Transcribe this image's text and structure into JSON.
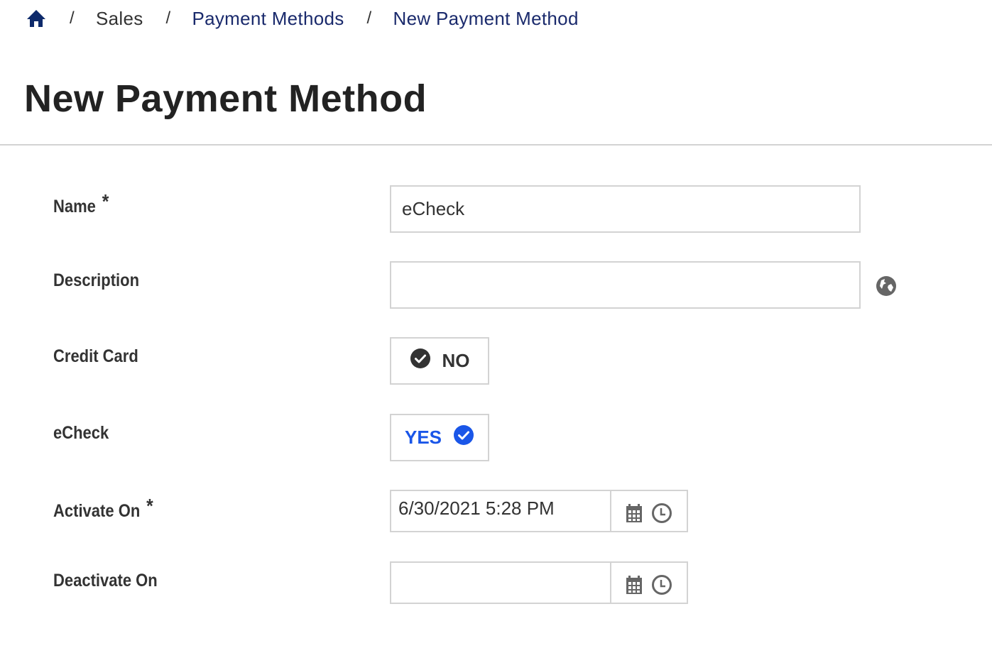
{
  "breadcrumb": {
    "home_icon": "home-icon",
    "separator": "/",
    "items": [
      {
        "label": "Sales",
        "link": false
      },
      {
        "label": "Payment Methods",
        "link": true
      },
      {
        "label": "New Payment Method",
        "link": true
      }
    ]
  },
  "page": {
    "title": "New Payment Method"
  },
  "colors": {
    "breadcrumb_link": "#1a2a6c",
    "home_icon": "#0e2a6b",
    "accent_yes": "#1a56e8",
    "toggle_no": "#333333",
    "border": "#d3d3d3",
    "icon_gray": "#666666"
  },
  "form": {
    "name": {
      "label": "Name",
      "required_mark": "*",
      "value": "eCheck"
    },
    "description": {
      "label": "Description",
      "value": "",
      "globe_icon": "globe-icon"
    },
    "credit_card": {
      "label": "Credit Card",
      "state_label": "NO",
      "checked": false,
      "icon": "check-circle-icon"
    },
    "echeck": {
      "label": "eCheck",
      "state_label": "YES",
      "checked": true,
      "icon": "check-circle-icon"
    },
    "activate_on": {
      "label": "Activate On",
      "required_mark": "*",
      "value": "6/30/2021 5:28 PM",
      "calendar_icon": "calendar-icon",
      "clock_icon": "clock-icon"
    },
    "deactivate_on": {
      "label": "Deactivate On",
      "value": "",
      "calendar_icon": "calendar-icon",
      "clock_icon": "clock-icon"
    }
  }
}
